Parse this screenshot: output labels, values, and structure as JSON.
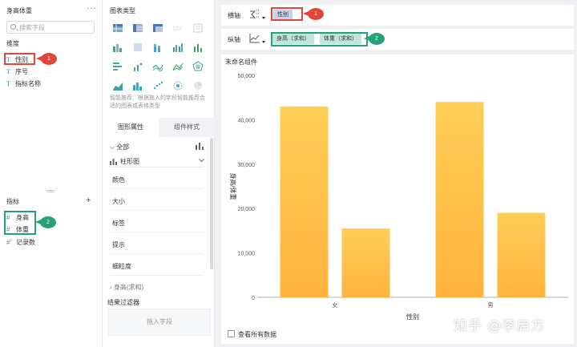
{
  "data_panel": {
    "title": "身高体重",
    "more": "···",
    "search_placeholder": "搜索字段",
    "dimension_label": "维度",
    "dimensions": [
      "性别",
      "序号",
      "指标名称"
    ],
    "measure_label": "指标",
    "measures": [
      "身高",
      "体重",
      "记录数"
    ],
    "add": "+"
  },
  "chart_panel": {
    "title": "图表类型",
    "hint": "智能推荐：根据拖入的字段智能推荐合适的图表或表格类型",
    "tabs": [
      "图形属性",
      "组件样式"
    ],
    "all_label": "全部",
    "chart_type_select": "柱形图",
    "props": [
      "颜色",
      "大小",
      "标签",
      "提示",
      "细粒度"
    ],
    "more_row": "身高(求和)",
    "filter_title": "结果过滤器",
    "drop_hint": "拖入字段"
  },
  "x_axis_bar": {
    "label": "横轴",
    "pill": "性别"
  },
  "y_axis_bar": {
    "label": "纵轴",
    "pills": [
      "身高（求和）",
      "体重（求和）"
    ]
  },
  "badges": {
    "one": "1",
    "two": "2"
  },
  "colors": {
    "dimension": "#c6d3ee",
    "measure": "#bfe6d8",
    "highlight_red": "#e2453c",
    "highlight_teal": "#26a27b",
    "bar_top": "#ffce58",
    "bar_bottom": "#ffb33c"
  },
  "canvas": {
    "card_title": "未命名组件",
    "show_all_label": "查看所有数据",
    "watermark": "知乎 @李启方"
  },
  "chart_data": {
    "type": "bar",
    "categories": [
      "女",
      "男"
    ],
    "series": [
      {
        "values": [
          43000,
          44000
        ]
      },
      {
        "values": [
          15500,
          19000
        ]
      }
    ],
    "xlabel": "性别",
    "ylabel": "身高/体重",
    "ylim": [
      0,
      50000
    ],
    "yticks": [
      "50,000",
      "40,000",
      "30,000",
      "20,000",
      "10,000",
      "0"
    ],
    "grid": false,
    "legend": "none"
  }
}
